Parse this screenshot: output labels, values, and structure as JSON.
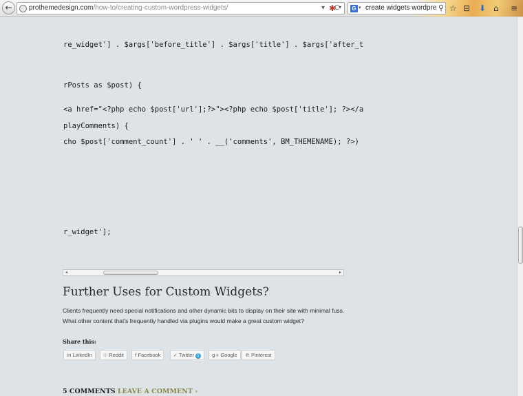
{
  "browser": {
    "back_glyph": "←",
    "url_domain": "prothemedesign.com",
    "url_path": "/how-to/creating-custom-wordpress-widgets/",
    "url_dropdown_icon": "dropdown-arrow-icon",
    "reload_glyph": "C",
    "search_engine_letter": "G",
    "search_query": "create widgets wordpress",
    "search_go_glyph": "⚲",
    "icons": {
      "bookmark_star": "☆",
      "library": "⊟",
      "download": "⬇",
      "home": "⌂",
      "menu": "≡"
    }
  },
  "code_lines": [
    "re_widget'] . $args['before_title'] . $args['title'] . $args['after_t",
    "rPosts as $post) {",
    "<a href=\"<?php echo $post['url'];?>\"><?php echo $post['title']; ?></a",
    "playComments) {",
    "cho $post['comment_count'] . ' ' . __('comments', BM_THEMENAME); ?>)",
    "r_widget'];"
  ],
  "section": {
    "title": "Further Uses for Custom Widgets?",
    "paragraph_lines": [
      "Clients frequently need special notifications and other dynamic bits to display on their site with minimal fuss.",
      "What other content that's frequently handled via plugins would make a great custom widget?"
    ]
  },
  "share": {
    "label": "Share this:",
    "buttons": [
      {
        "label": "LinkedIn",
        "icon": "in"
      },
      {
        "label": "Reddit",
        "icon": "☉"
      },
      {
        "label": "Facebook",
        "icon": "f"
      },
      {
        "label": "Twitter",
        "icon": "✓",
        "count": "1"
      },
      {
        "label": "Google",
        "icon": "g+"
      },
      {
        "label": "Pinterest",
        "icon": "℗"
      }
    ]
  },
  "comments": {
    "count_label": "5 COMMENTS",
    "leave_label": "LEAVE A COMMENT ›"
  }
}
